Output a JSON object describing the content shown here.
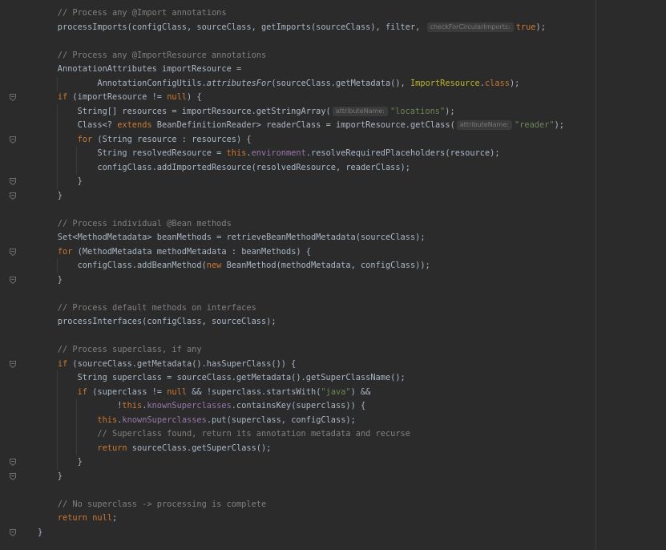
{
  "editor": {
    "lines": [
      {
        "indent": 0,
        "fold": false,
        "tokens": [
          [
            "cm",
            "    // Process any @Import annotations"
          ]
        ]
      },
      {
        "indent": 0,
        "fold": false,
        "tokens": [
          [
            "pl",
            "    processImports(configClass, sourceClass, getImports(sourceClass), filter, "
          ],
          [
            "hint",
            "checkForCircularImports:"
          ],
          [
            "kw",
            "true"
          ],
          [
            "pl",
            ");"
          ]
        ]
      },
      {
        "indent": 0,
        "fold": false,
        "tokens": []
      },
      {
        "indent": 0,
        "fold": false,
        "tokens": [
          [
            "cm",
            "    // Process any @ImportResource annotations"
          ]
        ]
      },
      {
        "indent": 0,
        "fold": false,
        "tokens": [
          [
            "pl",
            "    AnnotationAttributes importResource ="
          ]
        ]
      },
      {
        "indent": 1,
        "fold": false,
        "tokens": [
          [
            "pl",
            "            AnnotationConfigUtils."
          ],
          [
            "it",
            "attributesFor"
          ],
          [
            "pl",
            "(sourceClass.getMetadata(), "
          ],
          [
            "an",
            "ImportResource"
          ],
          [
            "pl",
            "."
          ],
          [
            "kw",
            "class"
          ],
          [
            "pl",
            ");"
          ]
        ]
      },
      {
        "indent": 0,
        "fold": true,
        "tokens": [
          [
            "pl",
            "    "
          ],
          [
            "kw",
            "if"
          ],
          [
            "pl",
            " (importResource != "
          ],
          [
            "kw",
            "null"
          ],
          [
            "pl",
            ") {"
          ]
        ]
      },
      {
        "indent": 1,
        "fold": false,
        "tokens": [
          [
            "pl",
            "        String[] resources = importResource.getStringArray("
          ],
          [
            "hint",
            "attributeName:"
          ],
          [
            "st",
            "\"locations\""
          ],
          [
            "pl",
            ");"
          ]
        ]
      },
      {
        "indent": 1,
        "fold": false,
        "tokens": [
          [
            "pl",
            "        Class<? "
          ],
          [
            "kw",
            "extends"
          ],
          [
            "pl",
            " BeanDefinitionReader> readerClass = importResource.getClass("
          ],
          [
            "hint",
            "attributeName:"
          ],
          [
            "st",
            "\"reader\""
          ],
          [
            "pl",
            ");"
          ]
        ]
      },
      {
        "indent": 1,
        "fold": true,
        "tokens": [
          [
            "pl",
            "        "
          ],
          [
            "kw",
            "for"
          ],
          [
            "pl",
            " (String resource : resources) {"
          ]
        ]
      },
      {
        "indent": 2,
        "fold": false,
        "tokens": [
          [
            "pl",
            "            String resolvedResource = "
          ],
          [
            "kw",
            "this"
          ],
          [
            "pl",
            "."
          ],
          [
            "fd",
            "environment"
          ],
          [
            "pl",
            ".resolveRequiredPlaceholders(resource);"
          ]
        ]
      },
      {
        "indent": 2,
        "fold": false,
        "tokens": [
          [
            "pl",
            "            configClass.addImportedResource(resolvedResource, readerClass);"
          ]
        ]
      },
      {
        "indent": 1,
        "fold": true,
        "tokens": [
          [
            "pl",
            "        }"
          ]
        ]
      },
      {
        "indent": 0,
        "fold": true,
        "tokens": [
          [
            "pl",
            "    }"
          ]
        ]
      },
      {
        "indent": 0,
        "fold": false,
        "tokens": []
      },
      {
        "indent": 0,
        "fold": false,
        "tokens": [
          [
            "cm",
            "    // Process individual @Bean methods"
          ]
        ]
      },
      {
        "indent": 0,
        "fold": false,
        "tokens": [
          [
            "pl",
            "    Set<MethodMetadata> beanMethods = retrieveBeanMethodMetadata(sourceClass);"
          ]
        ]
      },
      {
        "indent": 0,
        "fold": true,
        "tokens": [
          [
            "pl",
            "    "
          ],
          [
            "kw",
            "for"
          ],
          [
            "pl",
            " (MethodMetadata methodMetadata : beanMethods) {"
          ]
        ]
      },
      {
        "indent": 1,
        "fold": false,
        "tokens": [
          [
            "pl",
            "        configClass.addBeanMethod("
          ],
          [
            "kw",
            "new"
          ],
          [
            "pl",
            " BeanMethod(methodMetadata, configClass));"
          ]
        ]
      },
      {
        "indent": 0,
        "fold": true,
        "tokens": [
          [
            "pl",
            "    }"
          ]
        ]
      },
      {
        "indent": 0,
        "fold": false,
        "tokens": []
      },
      {
        "indent": 0,
        "fold": false,
        "tokens": [
          [
            "cm",
            "    // Process default methods on interfaces"
          ]
        ]
      },
      {
        "indent": 0,
        "fold": false,
        "tokens": [
          [
            "pl",
            "    processInterfaces(configClass, sourceClass);"
          ]
        ]
      },
      {
        "indent": 0,
        "fold": false,
        "tokens": []
      },
      {
        "indent": 0,
        "fold": false,
        "tokens": [
          [
            "cm",
            "    // Process superclass, if any"
          ]
        ]
      },
      {
        "indent": 0,
        "fold": true,
        "tokens": [
          [
            "pl",
            "    "
          ],
          [
            "kw",
            "if"
          ],
          [
            "pl",
            " (sourceClass.getMetadata().hasSuperClass()) {"
          ]
        ]
      },
      {
        "indent": 1,
        "fold": false,
        "tokens": [
          [
            "pl",
            "        String superclass = sourceClass.getMetadata().getSuperClassName();"
          ]
        ]
      },
      {
        "indent": 1,
        "fold": false,
        "tokens": [
          [
            "pl",
            "        "
          ],
          [
            "kw",
            "if"
          ],
          [
            "pl",
            " (superclass != "
          ],
          [
            "kw",
            "null"
          ],
          [
            "pl",
            " && !superclass.startsWith("
          ],
          [
            "st",
            "\"java\""
          ],
          [
            "pl",
            ") &&"
          ]
        ]
      },
      {
        "indent": 2,
        "fold": false,
        "tokens": [
          [
            "pl",
            "                !"
          ],
          [
            "kw",
            "this"
          ],
          [
            "pl",
            "."
          ],
          [
            "fd",
            "knownSuperclasses"
          ],
          [
            "pl",
            ".containsKey(superclass)) {"
          ]
        ]
      },
      {
        "indent": 2,
        "fold": false,
        "tokens": [
          [
            "pl",
            "            "
          ],
          [
            "kw",
            "this"
          ],
          [
            "pl",
            "."
          ],
          [
            "fd",
            "knownSuperclasses"
          ],
          [
            "pl",
            ".put(superclass, configClass);"
          ]
        ]
      },
      {
        "indent": 2,
        "fold": false,
        "tokens": [
          [
            "cm",
            "            // Superclass found, return its annotation metadata and recurse"
          ]
        ]
      },
      {
        "indent": 2,
        "fold": false,
        "tokens": [
          [
            "pl",
            "            "
          ],
          [
            "kw",
            "return"
          ],
          [
            "pl",
            " sourceClass.getSuperClass();"
          ]
        ]
      },
      {
        "indent": 1,
        "fold": true,
        "tokens": [
          [
            "pl",
            "        }"
          ]
        ]
      },
      {
        "indent": 0,
        "fold": true,
        "tokens": [
          [
            "pl",
            "    }"
          ]
        ]
      },
      {
        "indent": 0,
        "fold": false,
        "tokens": []
      },
      {
        "indent": 0,
        "fold": false,
        "tokens": [
          [
            "cm",
            "    // No superclass -> processing is complete"
          ]
        ]
      },
      {
        "indent": 0,
        "fold": false,
        "tokens": [
          [
            "pl",
            "    "
          ],
          [
            "kw",
            "return null"
          ],
          [
            "pl",
            ";"
          ]
        ]
      },
      {
        "indent": 0,
        "fold": true,
        "tokens": [
          [
            "pl",
            "}"
          ]
        ]
      }
    ]
  }
}
